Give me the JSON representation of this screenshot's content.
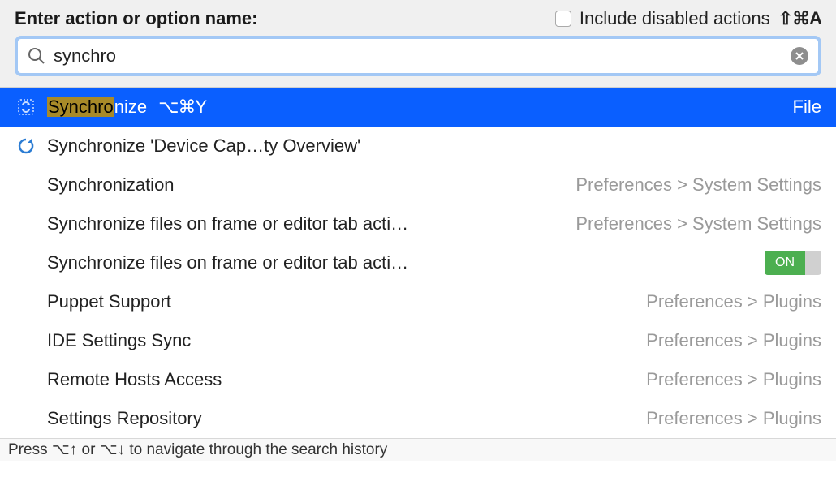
{
  "header": {
    "label": "Enter action or option name:",
    "checkbox_label": "Include disabled actions",
    "checkbox_shortcut": "⇧⌘A",
    "search_value": "synchro"
  },
  "rows": [
    {
      "text_prefix": "Synchro",
      "text_suffix": "nize",
      "shortcut": "⌥⌘Y",
      "right": "File",
      "selected": true,
      "icon": "sync"
    },
    {
      "text": "Synchronize 'Device Cap…ty Overview'",
      "icon": "refresh"
    },
    {
      "text": "Synchronization",
      "right": "Preferences > System Settings"
    },
    {
      "text": "Synchronize files on frame or editor tab acti…",
      "right": "Preferences > System Settings"
    },
    {
      "text": "Synchronize files on frame or editor tab acti…",
      "toggle": "ON"
    },
    {
      "text": "Puppet Support",
      "right": "Preferences > Plugins"
    },
    {
      "text": "IDE Settings Sync",
      "right": "Preferences > Plugins"
    },
    {
      "text": "Remote Hosts Access",
      "right": "Preferences > Plugins"
    },
    {
      "text": "Settings Repository",
      "right": "Preferences > Plugins"
    }
  ],
  "footer": "Press ⌥↑ or ⌥↓ to navigate through the search history"
}
